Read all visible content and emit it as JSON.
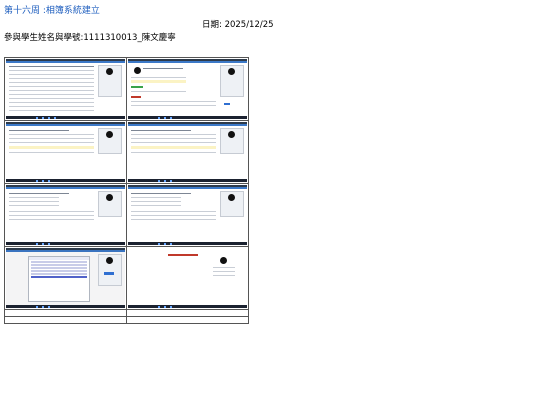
{
  "document": {
    "title": "第十六周 :相簿系統建立",
    "date_text": "日期: 2025/12/25",
    "student_text": "參與學生姓名與學號:1111310013_陳文慶寧"
  },
  "screenshot_cells": [
    {
      "name": "screenshot-album-list"
    },
    {
      "name": "screenshot-album-create"
    },
    {
      "name": "screenshot-photo-list-1"
    },
    {
      "name": "screenshot-photo-list-2"
    },
    {
      "name": "screenshot-photo-upload-1"
    },
    {
      "name": "screenshot-photo-upload-2"
    },
    {
      "name": "screenshot-photo-modal"
    },
    {
      "name": "screenshot-profile"
    }
  ],
  "colors": {
    "title": "#1f5fbf",
    "border": "#555555",
    "taskbar": "#1b2230",
    "accent_blue": "#3c79c8"
  }
}
